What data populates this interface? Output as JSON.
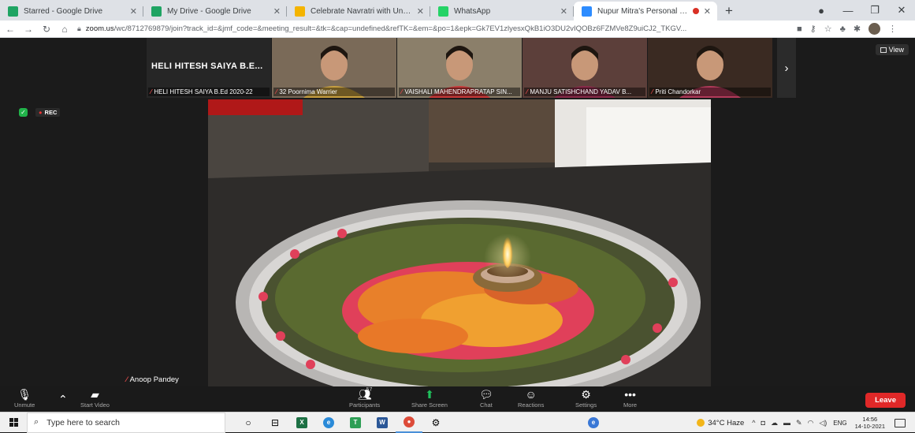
{
  "browser": {
    "tabs": [
      {
        "title": "Starred - Google Drive",
        "favicon_color": "#1fa463",
        "active": false
      },
      {
        "title": "My Drive - Google Drive",
        "favicon_color": "#1fa463",
        "active": false
      },
      {
        "title": "Celebrate Navratri with Unsung",
        "favicon_color": "#f4b400",
        "active": false
      },
      {
        "title": "WhatsApp",
        "favicon_color": "#25d366",
        "active": false
      },
      {
        "title": "Nupur Mitra's Personal Meet",
        "favicon_color": "#2d8cff",
        "active": true
      }
    ],
    "close_glyph": "✕",
    "newtab_glyph": "+",
    "url_host": "zoom.us",
    "url_rest": "/wc/8712769879/join?track_id=&jmf_code=&meeting_result=&tk=&cap=undefined&refTK=&em=&po=1&epk=Gk7EV1zlyesxQkB1iO3DU2vIQOBz6FZMVe8Z9uiCJ2_TKGV..."
  },
  "zoom": {
    "view_label": "View",
    "rec_label": "REC",
    "participants_strip": [
      {
        "display": "HELI HITESH SAIYA B.E...",
        "label": "HELI HITESH SAIYA B.Ed 2020-22",
        "bg": "#262626"
      },
      {
        "label": "32 Poornima Warrier",
        "bg": "#7a6a58"
      },
      {
        "label": "VAISHALI MAHENDRAPRATAP SIN...",
        "bg": "#8b7f6a"
      },
      {
        "label": "MANJU SATISHCHAND YADAV B...",
        "bg": "#5c3f3a"
      },
      {
        "label": "Priti Chandorkar",
        "bg": "#3a2a22"
      }
    ],
    "active_speaker": "Anoop Pandey",
    "toolbar": {
      "unmute": "Unmute",
      "start_video": "Start Video",
      "participants": "Participants",
      "participants_count": "57",
      "share_screen": "Share Screen",
      "chat": "Chat",
      "reactions": "Reactions",
      "settings": "Settings",
      "more": "More",
      "leave": "Leave"
    }
  },
  "taskbar": {
    "search_placeholder": "Type here to search",
    "weather": "34°C Haze",
    "lang": "ENG",
    "time": "14:56",
    "date": "14-10-2021"
  }
}
